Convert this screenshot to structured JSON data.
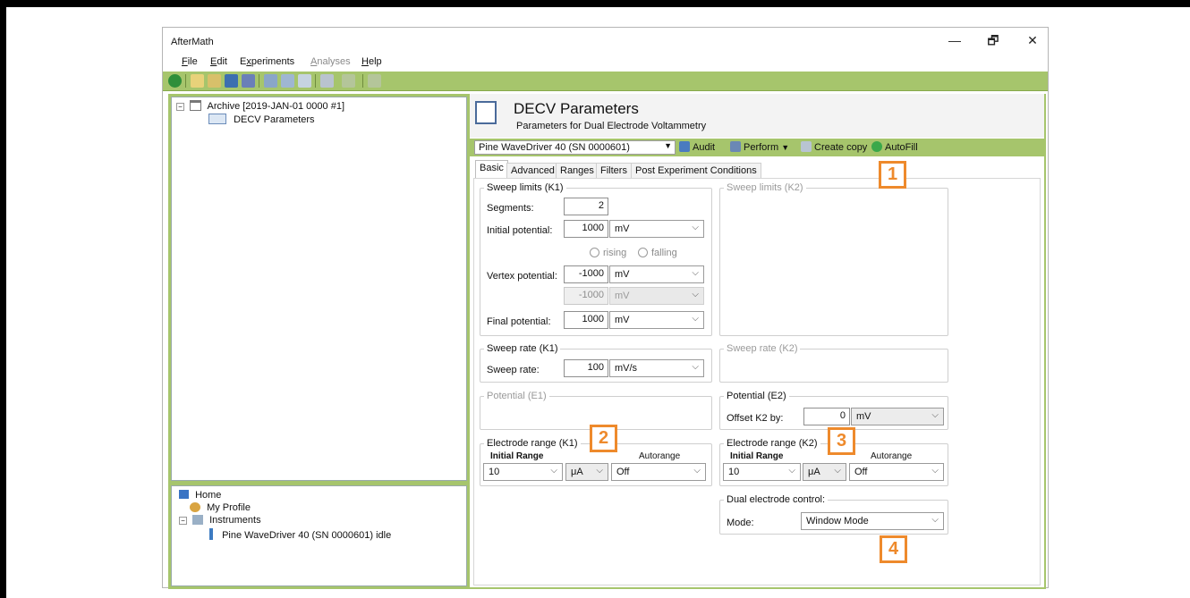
{
  "window": {
    "title": "AfterMath",
    "controls": {
      "minimize": "—",
      "restore": "🗗",
      "close": "✕"
    }
  },
  "menu": [
    {
      "label": "File",
      "accel": "F",
      "rest": "ile",
      "disabled": false
    },
    {
      "label": "Edit",
      "accel": "E",
      "rest": "dit",
      "disabled": false
    },
    {
      "label": "Experiments",
      "accel": "x",
      "pre": "E",
      "rest": "periments",
      "disabled": false
    },
    {
      "label": "Analyses",
      "accel": "A",
      "rest": "nalyses",
      "disabled": true
    },
    {
      "label": "Help",
      "accel": "H",
      "rest": "elp",
      "disabled": false
    }
  ],
  "tree_top": {
    "archive": "Archive [2019-JAN-01 0000 #1]",
    "child": "DECV Parameters"
  },
  "tree_bottom": {
    "home": "Home",
    "profile": "My Profile",
    "instruments": "Instruments",
    "instrument": "Pine WaveDriver 40 (SN 0000601) idle"
  },
  "header": {
    "title": "DECV Parameters",
    "subtitle": "Parameters for Dual Electrode Voltammetry"
  },
  "actionbar": {
    "instrument": "Pine WaveDriver 40 (SN 0000601)",
    "audit": "Audit",
    "perform": "Perform",
    "create_copy": "Create copy",
    "autofill": "AutoFill"
  },
  "tabs": [
    "Basic",
    "Advanced",
    "Ranges",
    "Filters",
    "Post Experiment Conditions"
  ],
  "sweep_k1": {
    "legend": "Sweep limits (K1)",
    "segments_label": "Segments:",
    "segments": "2",
    "initial_label": "Initial potential:",
    "initial": "1000",
    "initial_unit": "mV",
    "rising": "rising",
    "falling": "falling",
    "vertex_label": "Vertex potential:",
    "vertex": "-1000",
    "vertex_unit": "mV",
    "vertex2": "-1000",
    "vertex2_unit": "mV",
    "final_label": "Final potential:",
    "final": "1000",
    "final_unit": "mV"
  },
  "sweep_k2": {
    "legend": "Sweep limits (K2)"
  },
  "rate_k1": {
    "legend": "Sweep rate (K1)",
    "label": "Sweep rate:",
    "value": "100",
    "unit": "mV/s"
  },
  "rate_k2": {
    "legend": "Sweep rate (K2)"
  },
  "pot_e1": {
    "legend": "Potential (E1)"
  },
  "pot_e2": {
    "legend": "Potential (E2)",
    "label": "Offset K2 by:",
    "value": "0",
    "unit": "mV"
  },
  "range_k1": {
    "legend": "Electrode range (K1)",
    "initial_label": "Initial Range",
    "autorange_label": "Autorange",
    "value": "10",
    "unit": "μA",
    "autorange": "Off"
  },
  "range_k2": {
    "legend": "Electrode range (K2)",
    "initial_label": "Initial Range",
    "autorange_label": "Autorange",
    "value": "10",
    "unit": "μA",
    "autorange": "Off"
  },
  "dual": {
    "legend": "Dual electrode control:",
    "label": "Mode:",
    "value": "Window Mode"
  },
  "callouts": [
    "1",
    "2",
    "3",
    "4"
  ],
  "colors": {
    "accent_green": "#a6c56c",
    "callout_orange": "#ee8a2c"
  }
}
